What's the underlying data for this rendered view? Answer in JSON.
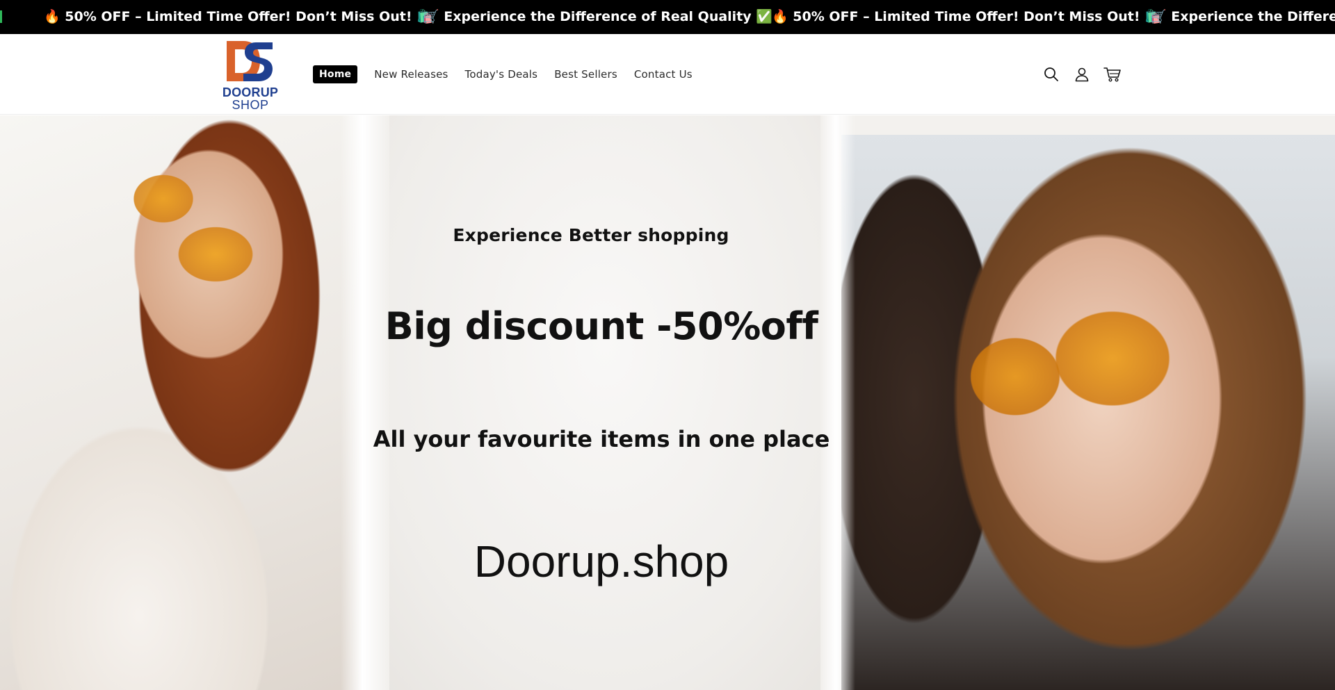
{
  "announcement": {
    "messages": [
      "🔥 50% OFF – Limited Time Offer! Don’t Miss Out! 🛍️",
      "🛒 Experience the Difference of Real Quality ✅",
      "🔥 50% OFF – Limited Time Offer! Don’t Miss Out! 🛍️",
      "🛒 Experience the Difference"
    ],
    "background": "#000000",
    "text_color": "#ffffff"
  },
  "header": {
    "logo": {
      "mark": "DS",
      "wordmark_line1": "DOORUP",
      "wordmark_line2": "SHOP",
      "colors": {
        "orange": "#d9622b",
        "blue": "#1f3f8f"
      }
    },
    "nav": [
      {
        "label": "Home",
        "active": true
      },
      {
        "label": "New Releases",
        "active": false
      },
      {
        "label": "Today's Deals",
        "active": false
      },
      {
        "label": "Best Sellers",
        "active": false
      },
      {
        "label": "Contact Us",
        "active": false
      }
    ],
    "icons": [
      "search-icon",
      "account-icon",
      "cart-icon"
    ]
  },
  "hero": {
    "subtitle": "Experience Better shopping",
    "headline": "Big discount -50%off",
    "tagline": "All your favourite items in one place",
    "brand": "Doorup.shop"
  }
}
